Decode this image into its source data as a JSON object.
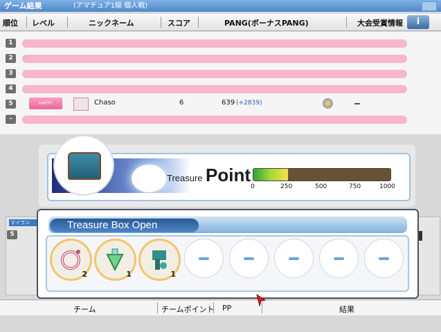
{
  "window": {
    "title": "ゲーム結果",
    "subtitle": "(アマチュア1級 個人戦)"
  },
  "header": {
    "rank": "順位",
    "level": "レベル",
    "nickname": "ニックネーム",
    "score": "スコア",
    "pang": "PANG(ボーナスPANG)",
    "tournament_info": "大会受賞情報",
    "info_button": "i"
  },
  "rows": [
    {
      "rank": "1"
    },
    {
      "rank": "2"
    },
    {
      "rank": "3"
    },
    {
      "rank": "4"
    },
    {
      "rank": "5",
      "badge": "HAPPY BIRTHDAY",
      "nickname": "Chaso",
      "score": "6",
      "pang": "639",
      "bonus": "(+2839)"
    },
    {
      "rank": "–"
    }
  ],
  "treasure_point": {
    "label_small": "Treasure",
    "label_large": "Point",
    "scale": [
      "0",
      "250",
      "500",
      "750",
      "1000"
    ],
    "value": 250,
    "max": 1000
  },
  "my_tab": {
    "label": "マイラン",
    "rank": "5"
  },
  "treasure_box": {
    "title": "Treasure Box Open",
    "slots": [
      {
        "icon": "ring-icon",
        "count": "2"
      },
      {
        "icon": "potion-icon",
        "count": "1"
      },
      {
        "icon": "club-icon",
        "count": "1"
      },
      {
        "icon": "empty-slot"
      },
      {
        "icon": "empty-slot"
      },
      {
        "icon": "empty-slot"
      },
      {
        "icon": "empty-slot"
      },
      {
        "icon": "empty-slot"
      }
    ]
  },
  "footer": {
    "team": "チーム",
    "team_point": "チームポイント",
    "pp": "PP",
    "result": "結果"
  },
  "colors": {
    "accent": "#4f87c9",
    "redaction": "#f7b6c9",
    "gauge_fill": "#a6d83a"
  }
}
